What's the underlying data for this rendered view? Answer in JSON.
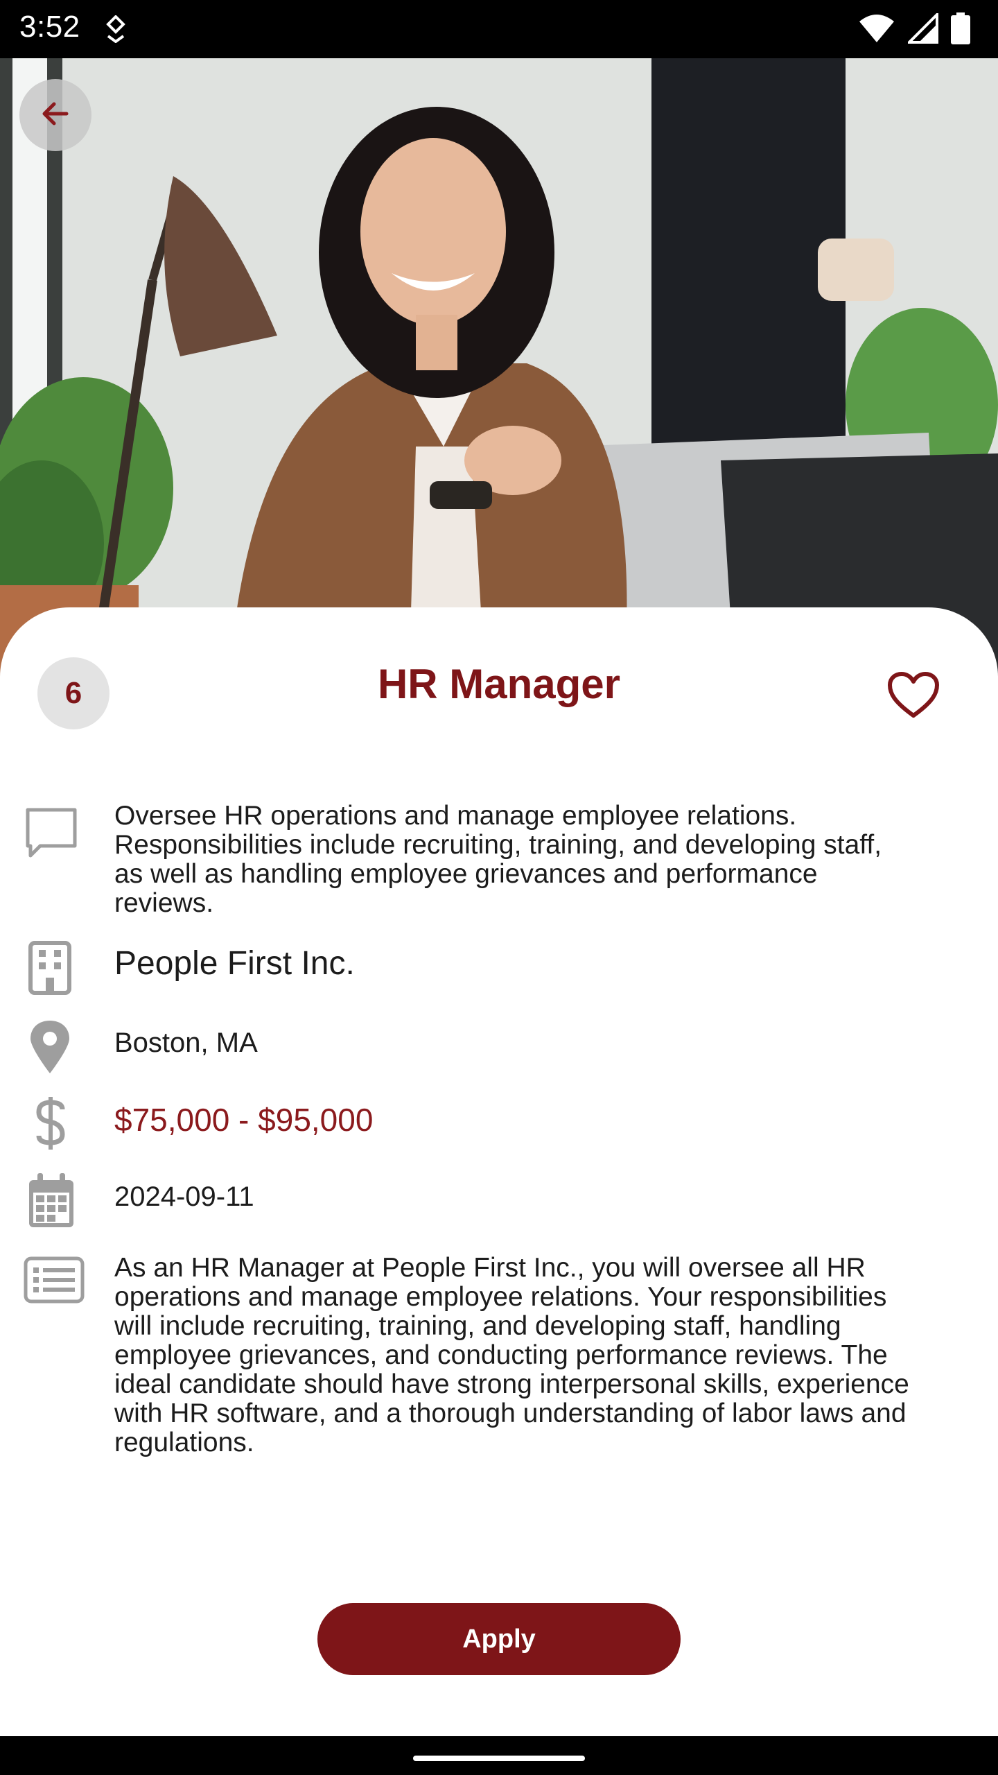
{
  "status_bar": {
    "time": "3:52",
    "icons": [
      "download-icon",
      "wifi-icon",
      "signal-icon",
      "battery-icon"
    ]
  },
  "hero": {
    "image_description_icon": "photo-icon",
    "back_icon": "arrow-left-icon"
  },
  "job": {
    "count": "6",
    "title": "HR Manager",
    "favorite_icon": "heart-outline-icon",
    "summary": "Oversee HR operations and manage employee relations. Responsibilities include recruiting, training, and developing staff, as well as handling employee grievances and performance reviews.",
    "company": "People First Inc.",
    "location": "Boston, MA",
    "salary": "$75,000 - $95,000",
    "date": "2024-09-11",
    "description": "As an HR Manager at People First Inc., you will oversee all HR operations and manage employee relations. Your responsibilities will include recruiting, training, and developing staff, handling employee grievances, and conducting performance reviews. The ideal candidate should have strong interpersonal skills, experience with HR software, and a thorough understanding of labor laws and regulations."
  },
  "actions": {
    "apply_label": "Apply"
  },
  "colors": {
    "accent": "#7e1518",
    "salary": "#8b1a1d",
    "icon_gray": "#9e9e9e"
  }
}
